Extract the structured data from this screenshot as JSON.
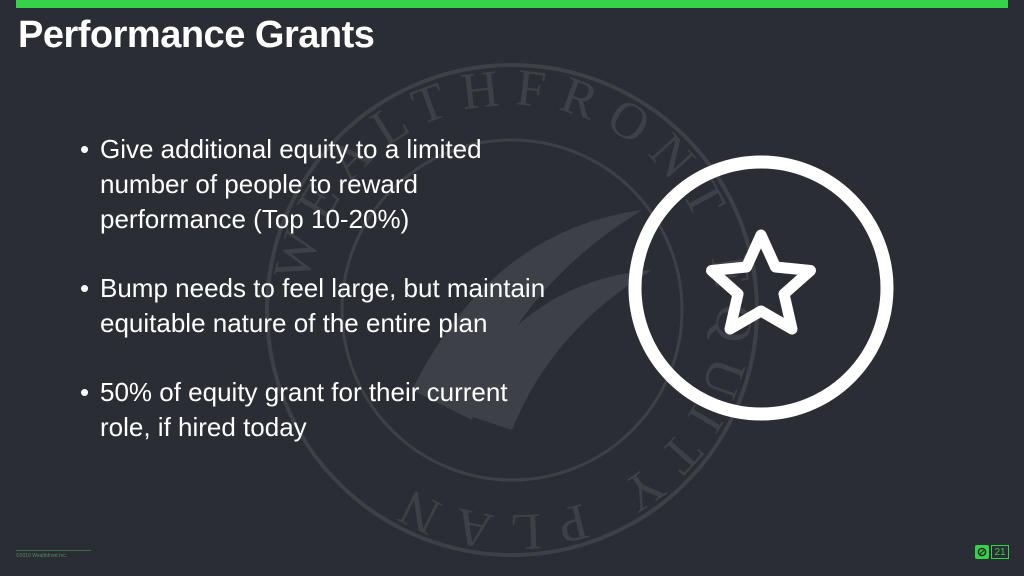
{
  "slide": {
    "title": "Performance Grants",
    "bullets": [
      "Give additional equity to a limited number of people to reward performance (Top 10-20%)",
      "Bump needs to feel large, but maintain equitable nature of the entire plan",
      "50% of equity grant for their current role, if hired today"
    ],
    "bullet_glyph": "•",
    "icon": "star-in-circle-icon",
    "watermark_text": "WEALTHFRONT EQUITY PLAN",
    "copyright": "©2019 Wealthfront Inc.",
    "slide_number": "21"
  },
  "colors": {
    "background": "#2a2d33",
    "accent": "#35d24a",
    "text": "#ffffff"
  }
}
